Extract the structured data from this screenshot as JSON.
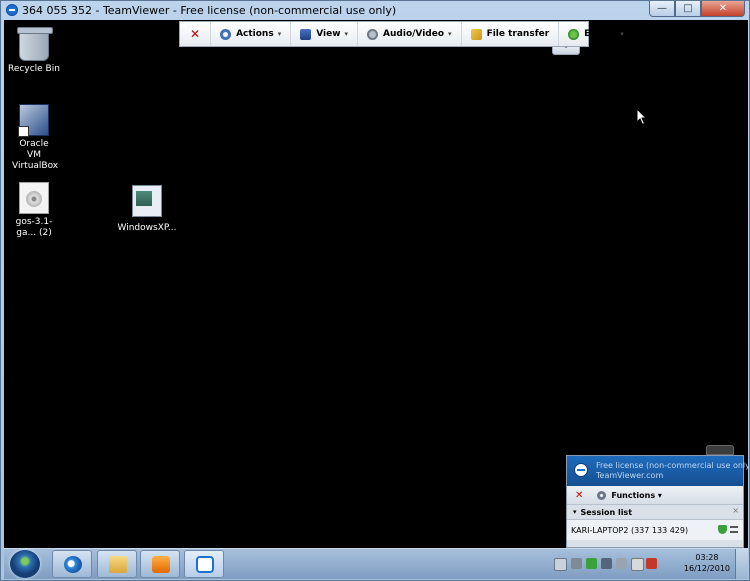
{
  "window": {
    "title": "364 055 352 - TeamViewer - Free license (non-commercial use only)",
    "buttons": {
      "minimize": "—",
      "maximize": "□",
      "close": "✕"
    }
  },
  "desktop": {
    "icons": [
      {
        "label": "Recycle Bin",
        "icon": "recycle-bin-icon"
      },
      {
        "label": "Oracle VM VirtualBox",
        "icon": "virtualbox-icon"
      },
      {
        "label": "gos-3.1-ga... (2)",
        "icon": "disc-image-icon"
      },
      {
        "label": "WindowsXP...",
        "icon": "vm-file-icon"
      }
    ]
  },
  "toolbar": {
    "close_label": "✕",
    "actions_label": "Actions",
    "view_label": "View",
    "audio_video_label": "Audio/Video",
    "file_transfer_label": "File transfer",
    "extras_label": "Extras",
    "caret": "▾",
    "collapse": "⌃"
  },
  "session_panel": {
    "license_line1": "Free license (non-commercial use only)",
    "license_line2": "TeamViewer.com",
    "close_label": "✕",
    "functions_label": "Functions ▾",
    "session_list_label": "Session list",
    "session_list_close": "×",
    "collapse_glyph": "▾",
    "session": "KARI-LAPTOP2 (337 133 429)"
  },
  "taskbar": {
    "pinned": [
      "internet-explorer-icon",
      "explorer-folder-icon",
      "media-player-icon",
      "teamviewer-icon"
    ],
    "clock_time": "03:28",
    "clock_date": "16/12/2010"
  },
  "colors": {
    "desktop_bg": "#000000",
    "teamviewer_blue": "#1f6fd1",
    "close_red": "#d00000"
  }
}
